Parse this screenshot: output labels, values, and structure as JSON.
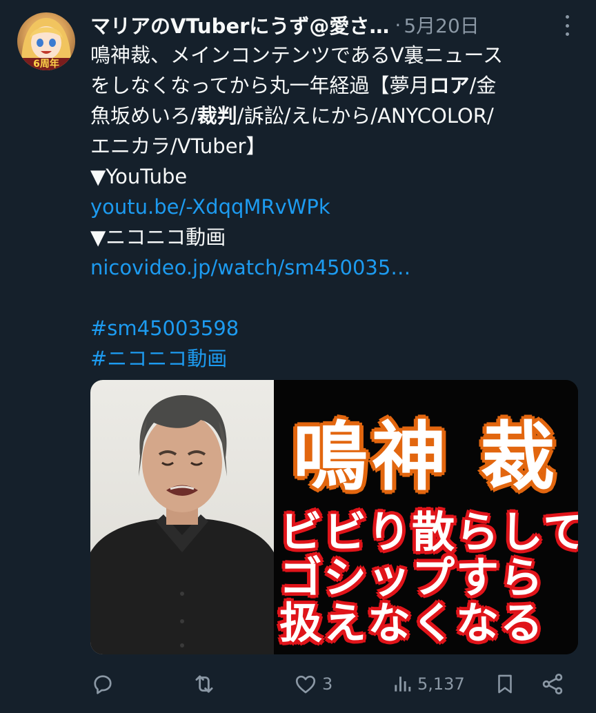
{
  "author": {
    "display_name": "マリアのVTuberにうず@愛さ…",
    "separator": "·",
    "date": "5月20日",
    "avatar_badge": "6周年"
  },
  "post": {
    "lines": [
      [
        {
          "text": "鳴神裁、メインコンテンツであるV裏ニュース"
        }
      ],
      [
        {
          "text": "をしなくなってから丸一年経過【夢月"
        },
        {
          "text": "ロア",
          "bold": true
        },
        {
          "text": "/金"
        }
      ],
      [
        {
          "text": "魚坂めいろ/"
        },
        {
          "text": "裁判",
          "bold": true
        },
        {
          "text": "/訴訟/えにから/ANYCOLOR/"
        }
      ],
      [
        {
          "text": "エニカラ/VTuber】"
        }
      ],
      [
        {
          "text": "▼YouTube"
        }
      ],
      [
        {
          "text": "youtu.be/-XdqqMRvWPk",
          "link": true
        }
      ],
      [
        {
          "text": "▼ニコニコ動画"
        }
      ],
      [
        {
          "text": "nicovideo.jp/watch/sm450035…",
          "link": true
        }
      ],
      [],
      [
        {
          "text": "#sm45003598",
          "link": true
        }
      ],
      [
        {
          "text": "#ニコニコ動画",
          "link": true
        }
      ]
    ]
  },
  "media": {
    "title": "鳴神 裁",
    "subtitle_lines": [
      "ビビり散らして",
      "ゴシップすら",
      "扱えなくなる"
    ]
  },
  "actions": {
    "reply_icon": "reply-icon",
    "repost_icon": "repost-icon",
    "like_icon": "heart-icon",
    "like_count": "3",
    "views_icon": "views-icon",
    "views_count": "5,137",
    "bookmark_icon": "bookmark-icon",
    "share_icon": "share-icon"
  },
  "colors": {
    "background": "#15202b",
    "text": "#f7f9f9",
    "secondary": "#8b98a5",
    "link": "#1d9bf0",
    "title_outline": "#e2660f",
    "subtitle_outline": "#e0141a"
  }
}
